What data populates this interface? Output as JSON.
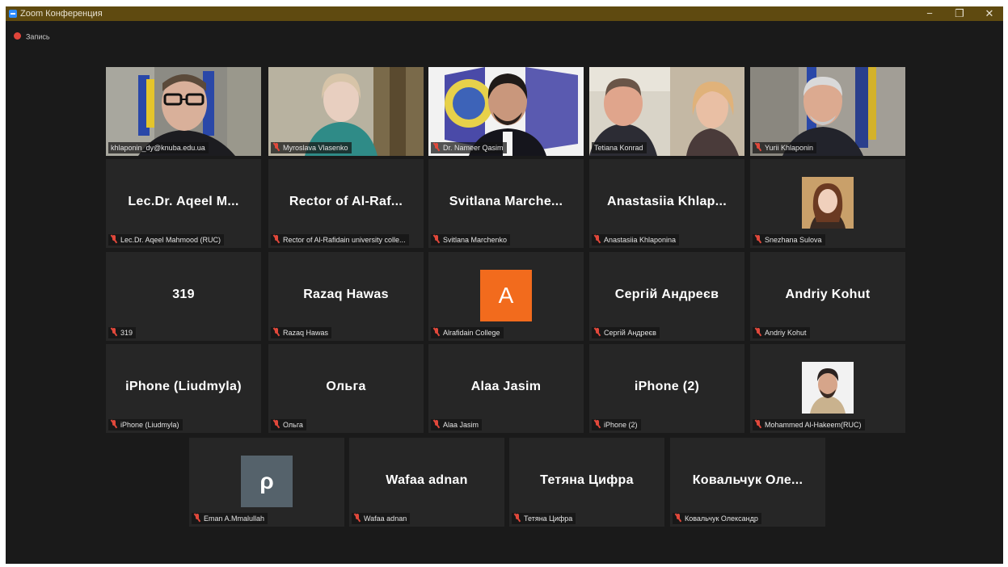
{
  "window": {
    "title": "Zoom Конференция",
    "controls": {
      "minimize": "−",
      "maximize": "❐",
      "close": "✕"
    }
  },
  "recording": {
    "label": "Запись"
  },
  "colors": {
    "title_bar": "#5f4a10",
    "background": "#1a1a1a",
    "tile": "#262626",
    "active_speaker_border": "#c5d733",
    "muted_mic": "#e1483b",
    "avatar_orange": "#f26b1d",
    "avatar_slate": "#55626b"
  },
  "participants": [
    {
      "label": "khlaponin_dy@knuba.edu.ua",
      "video": true,
      "active_speaker": true
    },
    {
      "label": "Myroslava Vlasenko",
      "video": true,
      "muted": true
    },
    {
      "label": "Dr. Nameer Qasim",
      "video": true,
      "muted": true
    },
    {
      "label": "Tetiana Konrad",
      "video": true
    },
    {
      "label": "Yurii Khlaponin",
      "video": true,
      "muted": true
    },
    {
      "display_name": "Lec.Dr. Aqeel M...",
      "label": "Lec.Dr. Aqeel Mahmood (RUC)",
      "muted": true
    },
    {
      "display_name": "Rector of Al-Raf...",
      "label": "Rector of Al-Rafidain university colle...",
      "muted": true
    },
    {
      "display_name": "Svitlana Marche...",
      "label": "Svitlana Marchenko",
      "muted": true
    },
    {
      "display_name": "Anastasiia Khlap...",
      "label": "Anastasiia Khlaponina",
      "muted": true
    },
    {
      "label": "Snezhana Sulova",
      "photo_avatar": true,
      "muted": true
    },
    {
      "display_name": "319",
      "label": "319",
      "muted": true
    },
    {
      "display_name": "Razaq Hawas",
      "label": "Razaq Hawas",
      "muted": true
    },
    {
      "avatar_letter": "A",
      "label": "Alrafidain College",
      "muted": true
    },
    {
      "display_name": "Сергій Андреєв",
      "label": "Сергій Андреєв",
      "muted": true
    },
    {
      "display_name": "Andriy Kohut",
      "label": "Andriy Kohut",
      "muted": true
    },
    {
      "display_name": "iPhone (Liudmyla)",
      "label": "iPhone (Liudmyla)",
      "muted": true
    },
    {
      "display_name": "Ольга",
      "label": "Ольга",
      "muted": true
    },
    {
      "display_name": "Alaa Jasim",
      "label": "Alaa Jasim",
      "muted": true
    },
    {
      "display_name": "iPhone (2)",
      "label": "iPhone (2)",
      "muted": true
    },
    {
      "label": "Mohammed Al-Hakeem(RUC)",
      "photo_avatar": true,
      "muted": true
    },
    {
      "avatar_letter": "ρ",
      "label": "Eman A.Mmalullah",
      "muted": true
    },
    {
      "display_name": "Wafaa adnan",
      "label": "Wafaa adnan",
      "muted": true
    },
    {
      "display_name": "Тетяна Цифра",
      "label": "Тетяна Цифра",
      "muted": true
    },
    {
      "display_name": "Ковальчук Оле...",
      "label": "Ковальчук Олександр",
      "muted": true
    }
  ]
}
